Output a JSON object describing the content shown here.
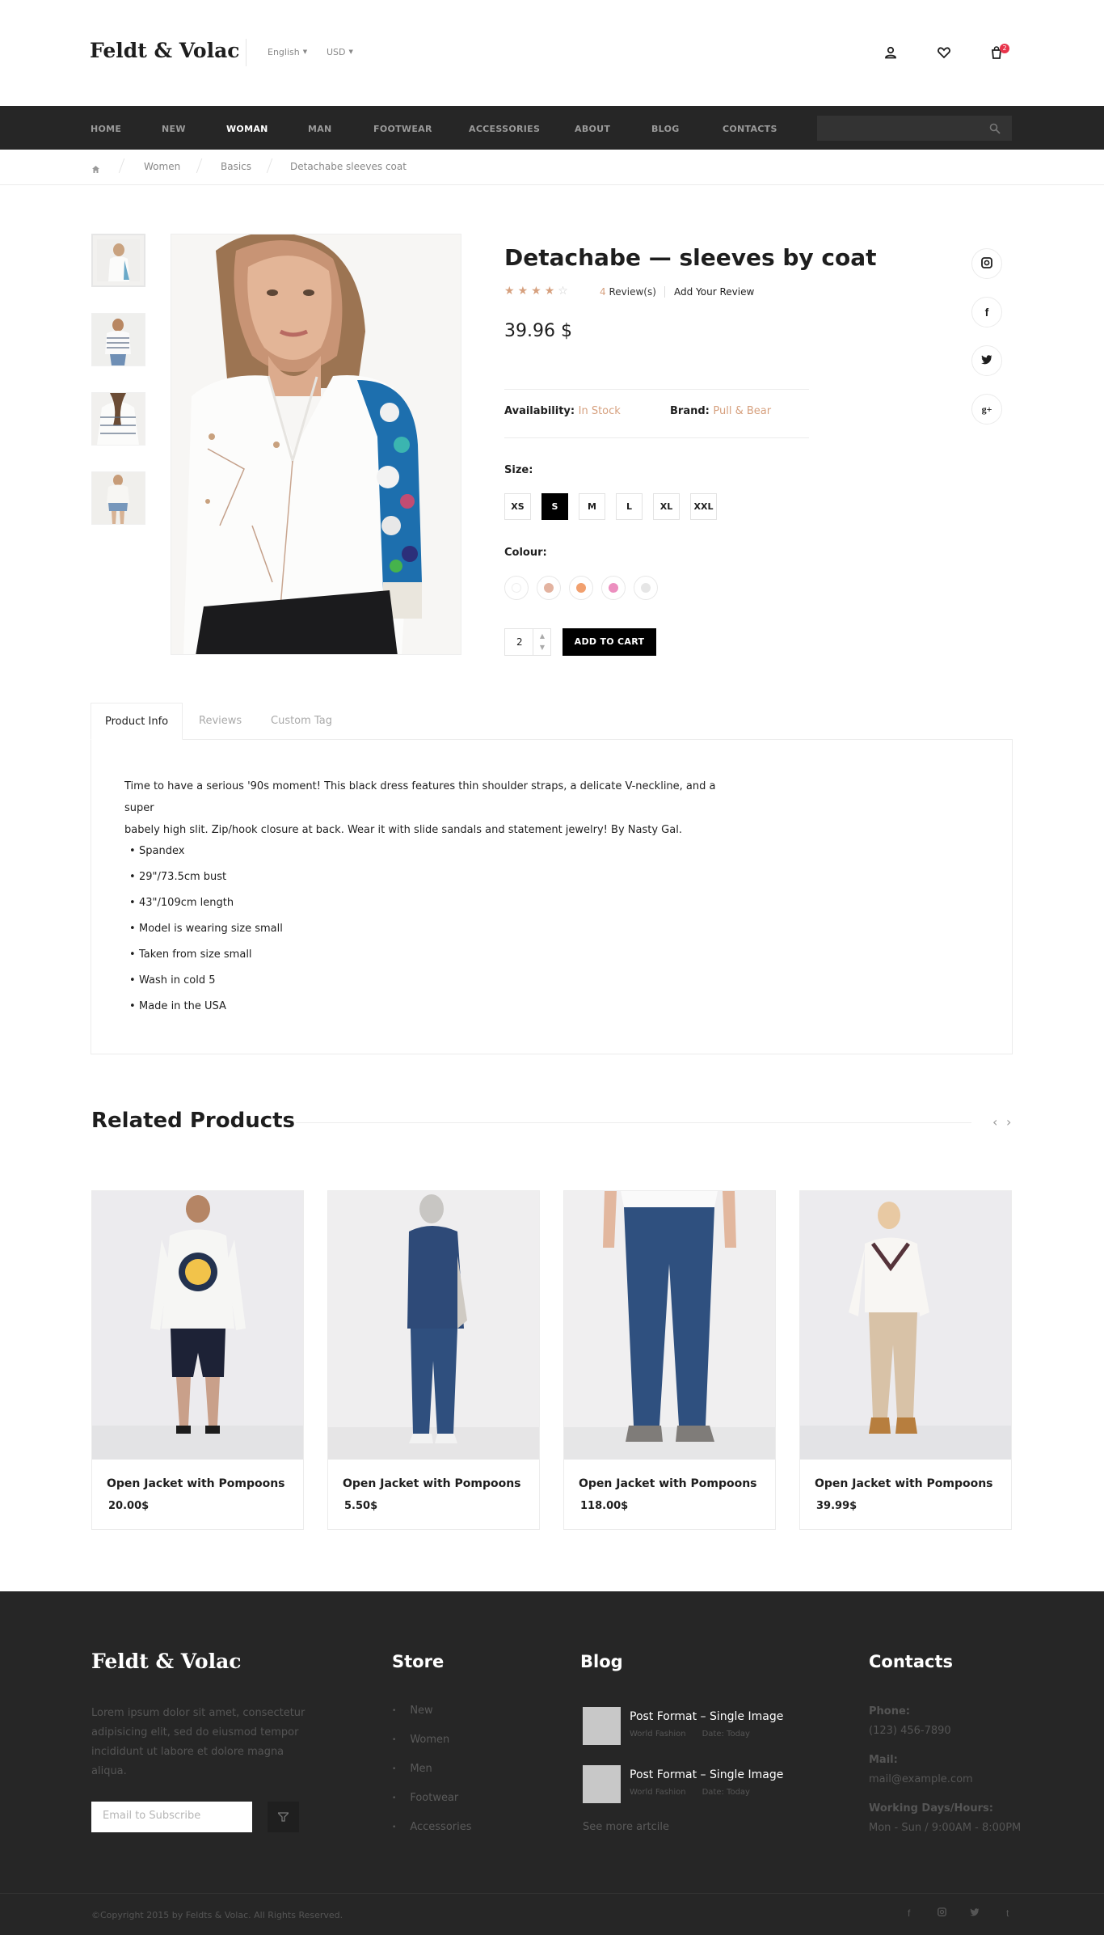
{
  "header": {
    "logo": "Feldt & Volac",
    "language": "English",
    "currency": "USD",
    "cart_count": "2",
    "icons": [
      "user-icon",
      "heart-icon",
      "cart-icon"
    ]
  },
  "nav": {
    "items": [
      "HOME",
      "NEW",
      "WOMAN",
      "MAN",
      "FOOTWEAR",
      "ACCESSORIES",
      "ABOUT",
      "BLOG",
      "CONTACTS"
    ],
    "active": "WOMAN"
  },
  "breadcrumb": [
    "Women",
    "Basics",
    "Detachabe sleeves coat"
  ],
  "product": {
    "title": "Detachabe — sleeves by coat",
    "rating": 4,
    "rating_max": 5,
    "review_count": "4",
    "review_suffix": " Review(s)",
    "add_review": "Add Your Review",
    "price": "39.96 $",
    "availability_label": "Availability:",
    "availability_value": "In Stock",
    "brand_label": "Brand:",
    "brand_value": "Pull & Bear",
    "size_label": "Size:",
    "sizes": [
      "XS",
      "S",
      "M",
      "L",
      "XL",
      "XXL"
    ],
    "selected_size": "S",
    "colour_label": "Colour:",
    "colours": [
      "#ffffff",
      "#e3b3a0",
      "#f1a06f",
      "#ec8fbf",
      "#e6e6e6"
    ],
    "quantity": "2",
    "add_to_cart": "ADD TO CART",
    "social_icons": [
      "instagram-icon",
      "facebook-icon",
      "twitter-icon",
      "google-plus-icon"
    ]
  },
  "tabs": {
    "items": [
      "Product Info",
      "Reviews",
      "Custom Tag"
    ],
    "active": "Product Info",
    "description_line1": "Time to have a serious '90s moment! This black dress features thin shoulder straps, a delicate V-neckline, and a super",
    "description_line2": "babely high slit. Zip/hook closure at back. Wear it with slide sandals and statement jewelry! By Nasty Gal.",
    "bullets": [
      "Spandex",
      "29\"/73.5cm bust",
      "43\"/109cm length",
      "Model is wearing size small",
      "Taken from size small",
      "Wash in cold 5",
      "Made in the USA"
    ]
  },
  "related": {
    "title": "Related Products",
    "products": [
      {
        "name": "Open Jacket with Pompoons",
        "price": "20.00$"
      },
      {
        "name": "Open Jacket with Pompoons",
        "price": "5.50$"
      },
      {
        "name": "Open Jacket with Pompoons",
        "price": "118.00$"
      },
      {
        "name": "Open Jacket with Pompoons",
        "price": "39.99$"
      }
    ]
  },
  "footer": {
    "logo": "Feldt & Volac",
    "description_lines": [
      "Lorem ipsum dolor sit amet, consectetur",
      "adipisicing elit, sed do eiusmod tempor",
      "incididunt ut labore et dolore magna",
      "aliqua."
    ],
    "subscribe_placeholder": "Email to Subscribe",
    "store_title": "Store",
    "store_links": [
      "New",
      "Women",
      "Men",
      "Footwear",
      "Accessories"
    ],
    "blog_title": "Blog",
    "blog_posts": [
      {
        "title": "Post Format – Single Image",
        "source": "World Fashion",
        "date": "Date: Today"
      },
      {
        "title": "Post Format – Single Image",
        "source": "World Fashion",
        "date": "Date: Today"
      }
    ],
    "blog_more": "See more artcile",
    "contacts_title": "Contacts",
    "phone_label": "Phone:",
    "phone": "(123) 456-7890",
    "mail_label": "Mail:",
    "mail": "mail@example.com",
    "hours_label": "Working Days/Hours:",
    "hours": "Mon - Sun / 9:00AM - 8:00PM",
    "copyright": "©Copyright 2015 by Feldts & Volac. All Rights Reserved.",
    "social_icons": [
      "facebook-icon",
      "instagram-icon",
      "twitter-icon",
      "tumblr-icon"
    ]
  }
}
